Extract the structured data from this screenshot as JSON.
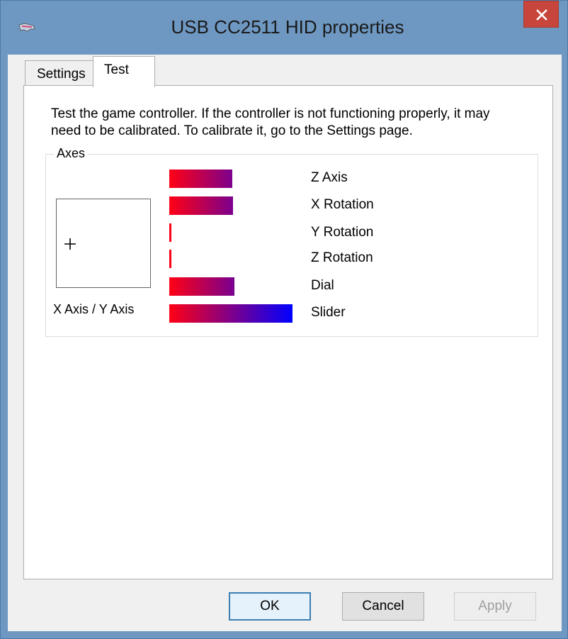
{
  "window": {
    "title": "USB CC2511 HID properties",
    "close_label": "✕"
  },
  "tabs": [
    {
      "label": "Settings",
      "active": false
    },
    {
      "label": "Test",
      "active": true
    }
  ],
  "test_page": {
    "description_line1": "Test the game controller.  If the controller is not functioning properly, it may",
    "description_line2": "need to be calibrated.  To calibrate it, go to the Settings page.",
    "axes_group": {
      "legend": "Axes",
      "xy_label": "X Axis / Y Axis",
      "axes": [
        {
          "label": "Z Axis",
          "level": 0.51
        },
        {
          "label": "X Rotation",
          "level": 0.52
        },
        {
          "label": "Y Rotation",
          "level": 0.0
        },
        {
          "label": "Z Rotation",
          "level": 0.0
        },
        {
          "label": "Dial",
          "level": 0.53
        },
        {
          "label": "Slider",
          "level": 1.0
        }
      ]
    }
  },
  "buttons": {
    "ok": "OK",
    "cancel": "Cancel",
    "apply": "Apply"
  },
  "colors": {
    "bar_start": "#ff0014",
    "bar_end": "#0000ff",
    "close_button": "#c7453b"
  }
}
